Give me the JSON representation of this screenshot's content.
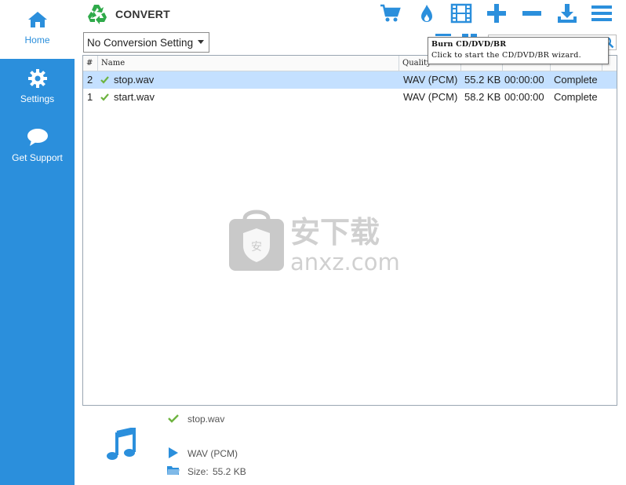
{
  "sidebar": {
    "items": [
      {
        "label": "Home",
        "icon": "home-icon"
      },
      {
        "label": "Settings",
        "icon": "gear-icon"
      },
      {
        "label": "Get Support",
        "icon": "speech-bubble-icon"
      }
    ],
    "active": "Home"
  },
  "header": {
    "title": "CONVERT",
    "logo_icon": "recycle-arrows-icon",
    "toolbar": [
      "cart-icon",
      "flame-icon",
      "film-icon",
      "plus-icon",
      "minus-icon",
      "download-icon",
      "hamburger-menu-icon"
    ]
  },
  "conversion_setting": {
    "selected": "No Conversion Setting"
  },
  "tooltip": {
    "title": "Burn CD/DVD/BR",
    "text": "Click to start the CD/DVD/BR wizard."
  },
  "table": {
    "columns": [
      "#",
      "Name",
      "Quality",
      "",
      "",
      ""
    ],
    "rows": [
      {
        "num": "2",
        "name": "stop.wav",
        "quality": "WAV (PCM)",
        "size": "55.2 KB",
        "duration": "00:00:00",
        "status": "Complete",
        "selected": true
      },
      {
        "num": "1",
        "name": "start.wav",
        "quality": "WAV (PCM)",
        "size": "58.2 KB",
        "duration": "00:00:00",
        "status": "Complete",
        "selected": false
      }
    ]
  },
  "details": {
    "filename": "stop.wav",
    "format": "WAV (PCM)",
    "size_label": "Size:",
    "size_value": "55.2 KB"
  },
  "watermark": {
    "cn_text": "安下载",
    "url_text": "anxz.com"
  },
  "colors": {
    "accent": "#2b8fdc",
    "logo_green": "#2faa4a",
    "check_green": "#6db33f",
    "selected_row": "#c4e0ff"
  }
}
